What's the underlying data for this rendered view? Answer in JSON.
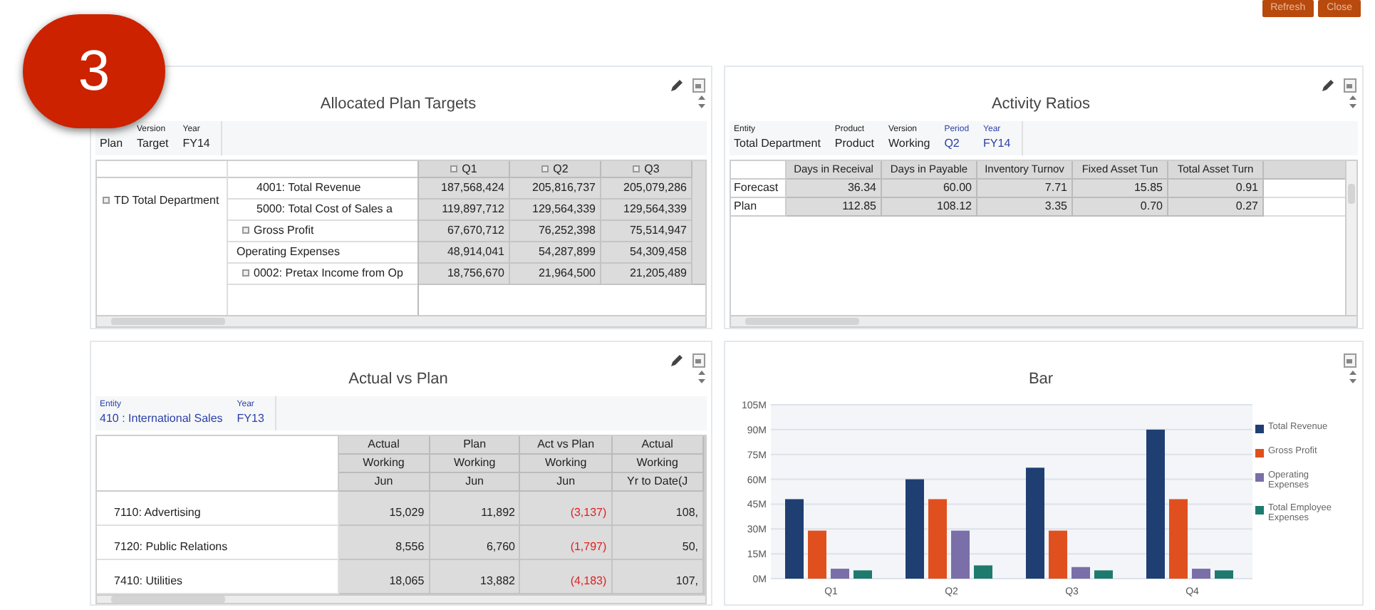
{
  "top_buttons": [
    {
      "label": "Refresh"
    },
    {
      "label": "Close"
    }
  ],
  "step_badge": "3",
  "allocated_plan": {
    "title": "Allocated Plan Targets",
    "pov": [
      {
        "value": "Plan",
        "linked": false
      },
      {
        "label": "Version",
        "value": "Target",
        "linked": false
      },
      {
        "label": "Year",
        "value": "FY14",
        "linked": false
      }
    ],
    "columns": [
      "Q1",
      "Q2",
      "Q3"
    ],
    "outer_row": "TD Total Department",
    "rows": [
      {
        "label": "Gross Profit",
        "expandable": true,
        "values": [
          "67,670,712",
          "76,252,398",
          "75,514,947"
        ],
        "children": [
          {
            "label": "4001: Total Revenue",
            "expandable": false,
            "values": [
              "187,568,424",
              "205,816,737",
              "205,079,286"
            ]
          },
          {
            "label": "5000: Total Cost of Sales a",
            "expandable": false,
            "values": [
              "119,897,712",
              "129,564,339",
              "129,564,339"
            ]
          }
        ]
      },
      {
        "label": "Operating Expenses",
        "expandable": false,
        "values": [
          "48,914,041",
          "54,287,899",
          "54,309,458"
        ]
      },
      {
        "label": "0002: Pretax Income from Op",
        "expandable": true,
        "values": [
          "18,756,670",
          "21,964,500",
          "21,205,489"
        ]
      }
    ]
  },
  "activity_ratios": {
    "title": "Activity Ratios",
    "pov": [
      {
        "label": "Entity",
        "value": "Total Department",
        "linked": false
      },
      {
        "label": "Product",
        "value": "Product",
        "linked": false
      },
      {
        "label": "Version",
        "value": "Working",
        "linked": false
      },
      {
        "label": "Period",
        "value": "Q2",
        "linked": true
      },
      {
        "label": "Year",
        "value": "FY14",
        "linked": true
      }
    ],
    "columns": [
      "Days in Receival",
      "Days in Payable",
      "Inventory Turnov",
      "Fixed Asset Tun",
      "Total Asset Turn"
    ],
    "rows": [
      {
        "label": "Forecast",
        "values": [
          "36.34",
          "60.00",
          "7.71",
          "15.85",
          "0.91"
        ]
      },
      {
        "label": "Plan",
        "values": [
          "112.85",
          "108.12",
          "3.35",
          "0.70",
          "0.27"
        ]
      }
    ]
  },
  "actual_vs_plan": {
    "title": "Actual vs Plan",
    "pov": [
      {
        "label": "Entity",
        "value": "410 : International Sales",
        "linked": true
      },
      {
        "label": "Year",
        "value": "FY13",
        "linked": true
      }
    ],
    "header_rows": [
      [
        "Actual",
        "Plan",
        "Act vs Plan",
        "Actual"
      ],
      [
        "Working",
        "Working",
        "Working",
        "Working"
      ],
      [
        "Jun",
        "Jun",
        "Jun",
        "Yr to Date(J"
      ]
    ],
    "rows": [
      {
        "label": "7110: Advertising",
        "cells": [
          {
            "text": "15,029",
            "negative": false
          },
          {
            "text": "11,892",
            "negative": false
          },
          {
            "text": "(3,137)",
            "negative": true
          },
          {
            "text": "108,",
            "negative": false
          }
        ]
      },
      {
        "label": "7120: Public Relations",
        "cells": [
          {
            "text": "8,556",
            "negative": false
          },
          {
            "text": "6,760",
            "negative": false
          },
          {
            "text": "(1,797)",
            "negative": true
          },
          {
            "text": "50,",
            "negative": false
          }
        ]
      },
      {
        "label": "7410: Utilities",
        "cells": [
          {
            "text": "18,065",
            "negative": false
          },
          {
            "text": "13,882",
            "negative": false
          },
          {
            "text": "(4,183)",
            "negative": true
          },
          {
            "text": "107,",
            "negative": false
          }
        ]
      }
    ]
  },
  "bar_panel": {
    "title": "Bar",
    "chart_data": {
      "type": "bar",
      "grid": true,
      "categories": [
        "Q1",
        "Q2",
        "Q3",
        "Q4"
      ],
      "ylim": [
        0,
        105
      ],
      "yticks": [
        {
          "value": 0,
          "label": "0M"
        },
        {
          "value": 15,
          "label": "15M"
        },
        {
          "value": 30,
          "label": "30M"
        },
        {
          "value": 45,
          "label": "45M"
        },
        {
          "value": 60,
          "label": "60M"
        },
        {
          "value": 75,
          "label": "75M"
        },
        {
          "value": 90,
          "label": "90M"
        },
        {
          "value": 105,
          "label": "105M"
        }
      ],
      "series": [
        {
          "name": "Total Revenue",
          "color": "#1f3f73",
          "values": [
            48,
            60,
            67,
            90
          ]
        },
        {
          "name": "Gross Profit",
          "color": "#e0501e",
          "values": [
            29,
            48,
            29,
            48
          ]
        },
        {
          "name": "Operating Expenses",
          "color": "#7a6fa8",
          "values": [
            6,
            29,
            7,
            6
          ]
        },
        {
          "name": "Total Employee Expenses",
          "color": "#1f7a6e",
          "values": [
            5,
            8,
            5,
            5
          ]
        }
      ]
    }
  }
}
